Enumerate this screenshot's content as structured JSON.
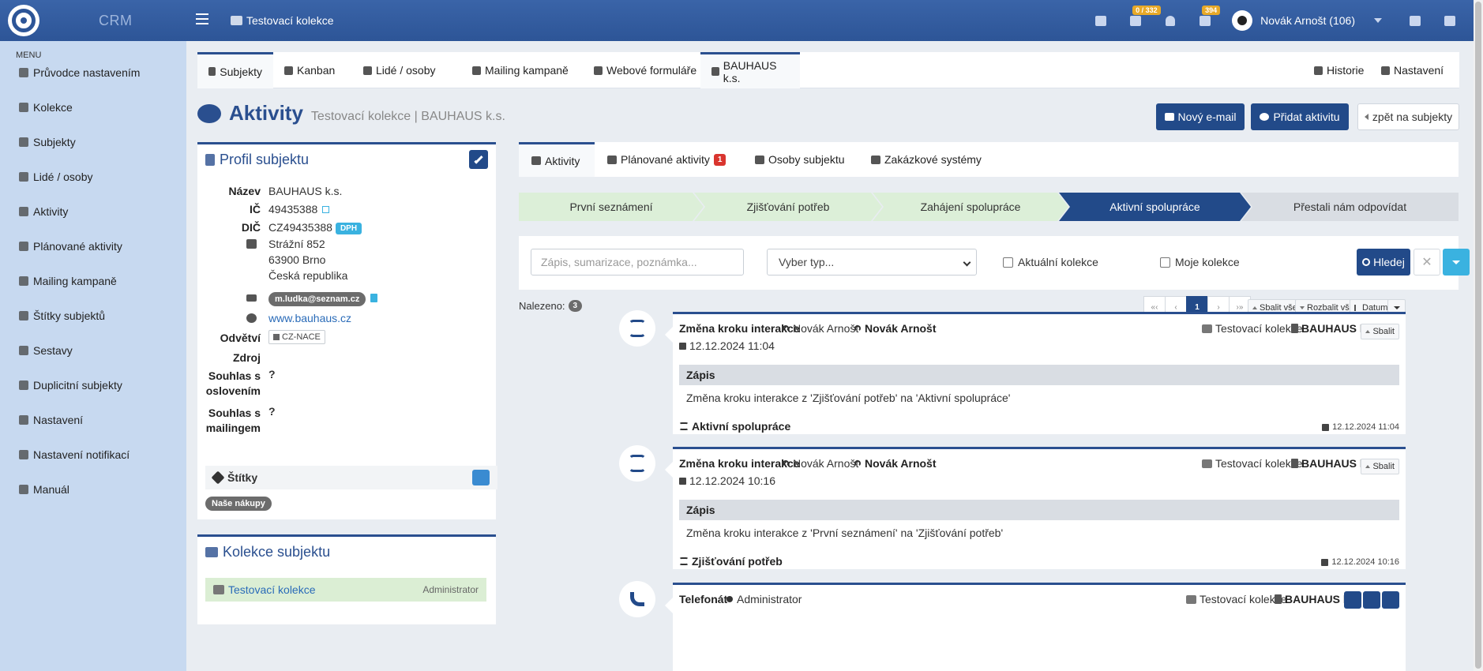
{
  "app": {
    "brand": "CRM",
    "breadcrumb": "Testovací kolekce",
    "tasks_badge": "0 / 332",
    "messages_badge": "394",
    "user": "Novák Arnošt (106)"
  },
  "sidebar": {
    "title": "MENU",
    "items": [
      {
        "label": "Průvodce nastavením",
        "icon": "pencil-icon"
      },
      {
        "label": "Kolekce",
        "icon": "briefcase-icon"
      },
      {
        "label": "Subjekty",
        "icon": "building-icon"
      },
      {
        "label": "Lidé / osoby",
        "icon": "person-icon"
      },
      {
        "label": "Aktivity",
        "icon": "comments-icon"
      },
      {
        "label": "Plánované aktivity",
        "icon": "calendar-icon"
      },
      {
        "label": "Mailing kampaně",
        "icon": "megaphone-icon"
      },
      {
        "label": "Štítky subjektů",
        "icon": "tags-icon"
      },
      {
        "label": "Sestavy",
        "icon": "report-icon"
      },
      {
        "label": "Duplicitní subjekty",
        "icon": "search-duplicate-icon"
      },
      {
        "label": "Nastavení",
        "icon": "gears-icon"
      },
      {
        "label": "Nastavení notifikací",
        "icon": "bell-icon"
      },
      {
        "label": "Manuál",
        "icon": "book-icon"
      }
    ]
  },
  "tabs": [
    {
      "label": "Subjekty"
    },
    {
      "label": "Kanban"
    },
    {
      "label": "Lidé / osoby"
    },
    {
      "label": "Mailing kampaně"
    },
    {
      "label": "Webové formuláře"
    },
    {
      "label": "BAUHAUS k.s."
    }
  ],
  "tabs_right": [
    {
      "label": "Historie"
    },
    {
      "label": "Nastavení"
    }
  ],
  "page": {
    "title": "Aktivity",
    "subtitle": "Testovací kolekce | BAUHAUS k.s.",
    "btn_email": "Nový e-mail",
    "btn_add": "Přidat aktivitu",
    "btn_back": "zpět na subjekty"
  },
  "profile": {
    "title": "Profil subjektu",
    "name_label": "Název",
    "name": "BAUHAUS k.s.",
    "ic_label": "IČ",
    "ic": "49435388",
    "dic_label": "DIČ",
    "dic": "CZ49435388",
    "dph": "DPH",
    "address_line1": "Strážní 852",
    "address_line2": "63900 Brno",
    "address_line3": "Česká republika",
    "email": "m.ludka@seznam.cz",
    "web": "www.bauhaus.cz",
    "odvetvi_label": "Odvětví",
    "nace": "CZ-NACE",
    "zdroj_label": "Zdroj",
    "souhlas_osloveni_label1": "Souhlas s",
    "souhlas_osloveni_label2": "oslovením",
    "souhlas_osloveni": "?",
    "souhlas_mailing_label1": "Souhlas s",
    "souhlas_mailing_label2": "mailingem",
    "souhlas_mailing": "?",
    "stitky_label": "Štítky",
    "tag": "Naše nákupy"
  },
  "collections": {
    "title": "Kolekce subjektu",
    "item_name": "Testovací kolekce",
    "item_role": "Administrator"
  },
  "subtabs": [
    {
      "label": "Aktivity"
    },
    {
      "label": "Plánované aktivity",
      "badge": "1"
    },
    {
      "label": "Osoby subjektu"
    },
    {
      "label": "Zakázkové systémy"
    }
  ],
  "pipeline": [
    {
      "label": "První seznámení",
      "state": "done"
    },
    {
      "label": "Zjišťování potřeb",
      "state": "done"
    },
    {
      "label": "Zahájení spolupráce",
      "state": "done"
    },
    {
      "label": "Aktivní spolupráce",
      "state": "current"
    },
    {
      "label": "Přestali nám odpovídat",
      "state": "todo"
    }
  ],
  "filter": {
    "search_placeholder": "Zápis, sumarizace, poznámka...",
    "type_select": "Vyber typ...",
    "check_current": "Aktuální kolekce",
    "check_mine": "Moje kolekce",
    "search_btn": "Hledej"
  },
  "results": {
    "found_label": "Nalezeno:",
    "count": "3",
    "pager": [
      "«‹",
      "‹",
      "1",
      "›",
      "›»"
    ],
    "collapse_all": "Sbalit vše",
    "expand_all": "Rozbalit vše",
    "sort": "Datum"
  },
  "activities": [
    {
      "title": "Změna kroku interakce",
      "user1": "Novák Arnošt",
      "user2": "Novák Arnošt",
      "date": "12.12.2024 11:04",
      "collection": "Testovací kolekce",
      "subject": "BAUHAUS k.s.",
      "collapse": "Sbalit",
      "note_header": "Zápis",
      "note": "Změna kroku interakce z 'Zjišťování potřeb' na 'Aktivní spolupráce'",
      "step": "Aktivní spolupráce",
      "stamp": "12.12.2024 11:04"
    },
    {
      "title": "Změna kroku interakce",
      "user1": "Novák Arnošt",
      "user2": "Novák Arnošt",
      "date": "12.12.2024 10:16",
      "collection": "Testovací kolekce",
      "subject": "BAUHAUS k.s.",
      "collapse": "Sbalit",
      "note_header": "Zápis",
      "note": "Změna kroku interakce z 'První seznámení' na 'Zjišťování potřeb'",
      "step": "Zjišťování potřeb",
      "stamp": "12.12.2024 10:16"
    },
    {
      "title": "Telefonát",
      "user1": "Administrator",
      "collection": "Testovací kolekce",
      "subject": "BAUHAUS k.s."
    }
  ]
}
